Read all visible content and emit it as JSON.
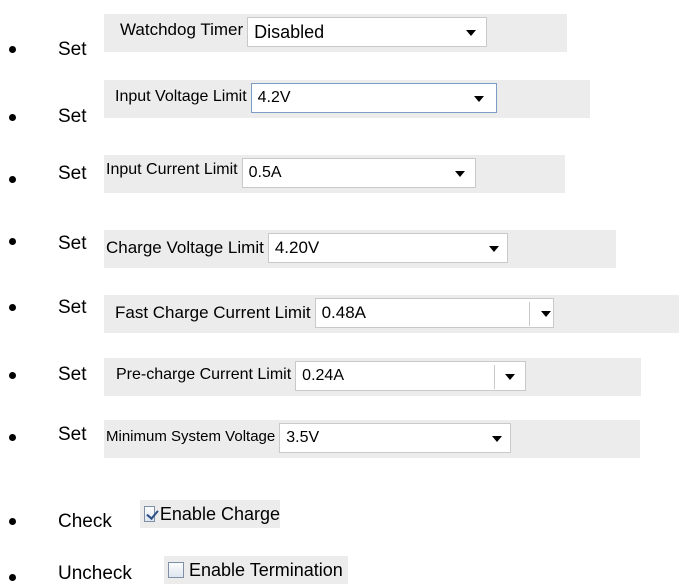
{
  "steps": [
    {
      "verb": "Set",
      "label": "Watchdog Timer",
      "value": "Disabled"
    },
    {
      "verb": "Set",
      "label": "Input Voltage Limit",
      "value": "4.2V"
    },
    {
      "verb": "Set",
      "label": "Input Current Limit",
      "value": "0.5A"
    },
    {
      "verb": "Set",
      "label": "Charge Voltage Limit",
      "value": "4.20V"
    },
    {
      "verb": "Set",
      "label": "Fast Charge Current Limit",
      "value": "0.48A"
    },
    {
      "verb": "Set",
      "label": "Pre-charge Current Limit",
      "value": "0.24A"
    },
    {
      "verb": "Set",
      "label": "Minimum System Voltage",
      "value": "3.5V"
    },
    {
      "verb": "Check",
      "label": "Enable Charge",
      "checked": true
    },
    {
      "verb": "Uncheck",
      "label": "Enable Termination",
      "checked": false
    }
  ],
  "icons": {
    "bullet": "bullet-dot",
    "dropdown": "chevron-down-icon",
    "checkbox": "checkbox-icon"
  },
  "colors": {
    "widget_bg": "#ececec",
    "select_border": "#c9c9c9",
    "focus_border": "#7d9bc5",
    "check_mark": "#2d4f88"
  }
}
